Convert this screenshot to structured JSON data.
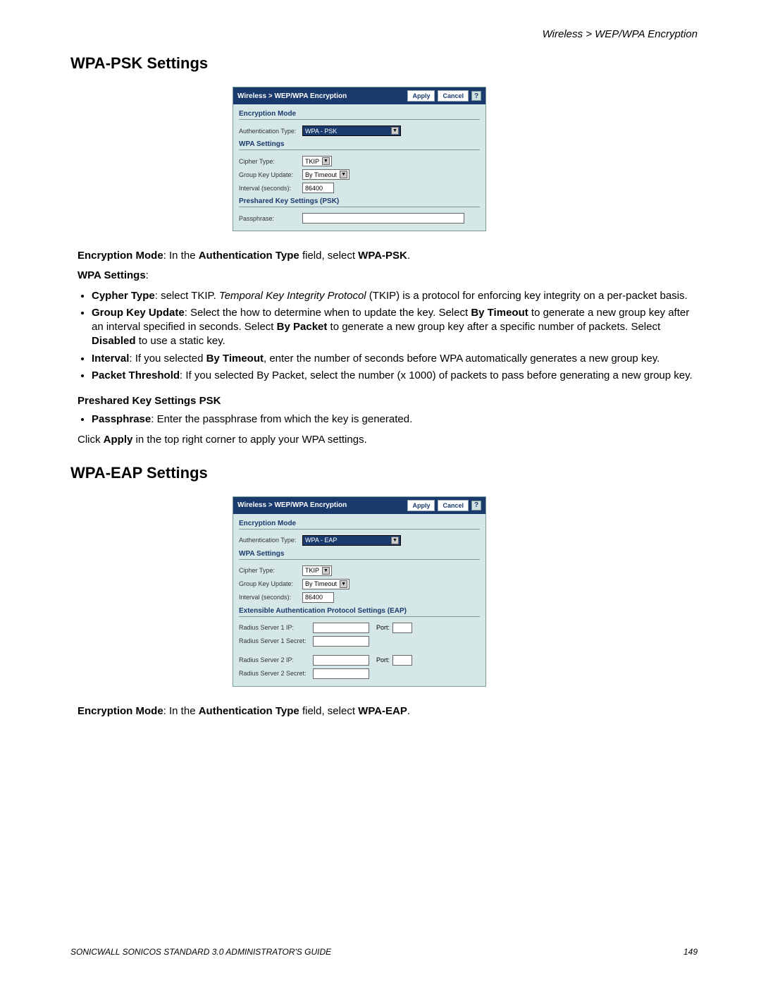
{
  "breadcrumb": "Wireless > WEP/WPA Encryption",
  "heading_psk": "WPA-PSK Settings",
  "heading_eap": "WPA-EAP Settings",
  "panel1": {
    "title": "Wireless > WEP/WPA Encryption",
    "apply": "Apply",
    "cancel": "Cancel",
    "help": "?",
    "sec_encryption": "Encryption Mode",
    "auth_type_label": "Authentication Type:",
    "auth_type_value": "WPA - PSK",
    "sec_wpa": "WPA Settings",
    "cipher_label": "Cipher Type:",
    "cipher_value": "TKIP",
    "gku_label": "Group Key Update:",
    "gku_value": "By Timeout",
    "interval_label": "Interval (seconds):",
    "interval_value": "86400",
    "sec_psk": "Preshared Key Settings (PSK)",
    "passphrase_label": "Passphrase:",
    "passphrase_value": ""
  },
  "panel2": {
    "title": "Wireless > WEP/WPA Encryption",
    "apply": "Apply",
    "cancel": "Cancel",
    "help": "?",
    "sec_encryption": "Encryption Mode",
    "auth_type_label": "Authentication Type:",
    "auth_type_value": "WPA - EAP",
    "sec_wpa": "WPA Settings",
    "cipher_label": "Cipher Type:",
    "cipher_value": "TKIP",
    "gku_label": "Group Key Update:",
    "gku_value": "By Timeout",
    "interval_label": "Interval (seconds):",
    "interval_value": "86400",
    "sec_eap": "Extensible Authentication Protocol Settings (EAP)",
    "r1ip_label": "Radius Server 1 IP:",
    "r1ip_value": "",
    "port_label": "Port:",
    "r1port_value": "",
    "r1secret_label": "Radius Server 1 Secret:",
    "r1secret_value": "",
    "r2ip_label": "Radius Server 2 IP:",
    "r2ip_value": "",
    "r2port_value": "",
    "r2secret_label": "Radius Server 2 Secret:",
    "r2secret_value": ""
  },
  "doc": {
    "enc_mode_b": "Encryption Mode",
    "enc_mode_mid": ": In the ",
    "enc_mode_b2": "Authentication Type",
    "enc_mode_mid2": " field, select ",
    "enc_mode_b3_psk": "WPA-PSK",
    "enc_mode_b3_eap": "WPA-EAP",
    "period": ".",
    "wpa_settings": "WPA Settings",
    "colon": ":",
    "cypher_b": "Cypher Type",
    "cypher_t1": ": select TKIP. ",
    "cypher_i": "Temporal Key Integrity Protocol",
    "cypher_t2": " (TKIP) is a protocol for enforcing key integrity on a per-packet basis.",
    "gku_b": "Group Key Update",
    "gku_t1": ": Select the how to determine when to update the key. Select ",
    "gku_b2": "By Timeout",
    "gku_t2": " to generate a new group key after an interval specified in seconds. Select ",
    "gku_b3": "By Packet",
    "gku_t3": " to generate a new group key after a specific number of packets. Select ",
    "gku_b4": "Disabled",
    "gku_t4": " to use a static key.",
    "interval_b": "Interval",
    "interval_t1": ": If you selected ",
    "interval_b2": "By Timeout",
    "interval_t2": ", enter the number of seconds before WPA automatically generates a new group key.",
    "pkt_b": "Packet Threshold",
    "pkt_t": ": If you selected By Packet, select the number (x 1000) of packets to pass before generating a new group key.",
    "psk_heading": "Preshared Key Settings PSK",
    "pass_b": "Passphrase",
    "pass_t": ": Enter the passphrase from which the key is generated.",
    "apply_t1": "Click ",
    "apply_b": "Apply",
    "apply_t2": " in the top right corner to apply your WPA settings."
  },
  "footer": {
    "left": "SONICWALL SONICOS STANDARD 3.0 ADMINISTRATOR'S GUIDE",
    "right": "149"
  }
}
